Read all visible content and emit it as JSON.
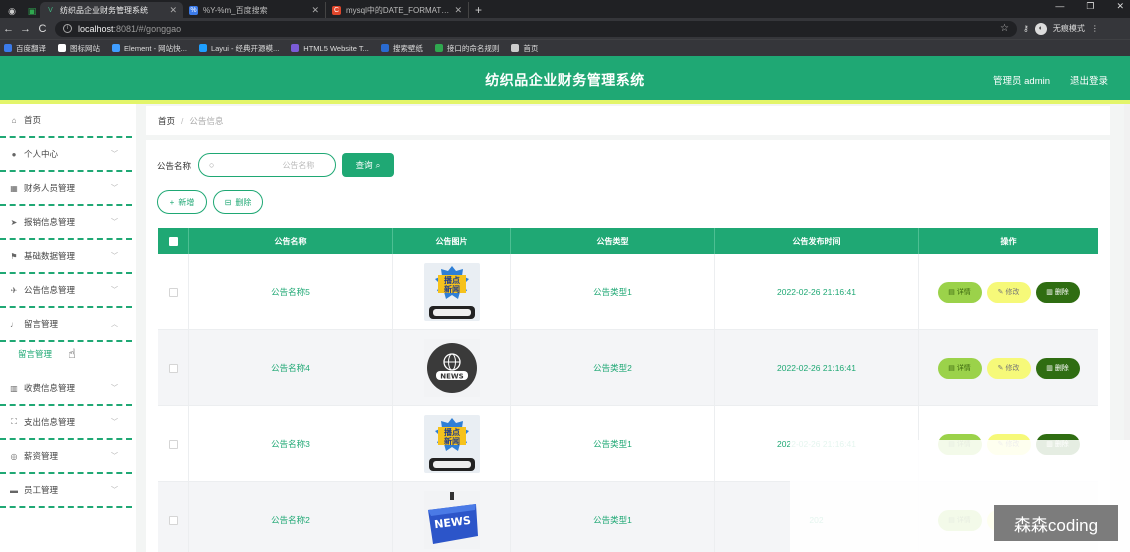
{
  "browser": {
    "tabs": [
      {
        "title": "纺织品企业财务管理系统",
        "active": true
      },
      {
        "title": "%Y-%m_百度搜索",
        "active": false
      },
      {
        "title": "mysql中的DATE_FORMAT(NO...",
        "active": false
      }
    ],
    "new_tab": "+",
    "url_host": "localhost",
    "url_path": ":8081/#/gonggao",
    "incognito_label": "无痕模式",
    "bookmarks": [
      {
        "label": "百度翻译",
        "color": "#3b7bea"
      },
      {
        "label": "图标网站",
        "color": "#ffffff"
      },
      {
        "label": "Element - 网站快...",
        "color": "#409eff"
      },
      {
        "label": "Layui - 经典开源模...",
        "color": "#1e9fff"
      },
      {
        "label": "HTML5 Website T...",
        "color": "#7b5cd6"
      },
      {
        "label": "搜索壁纸",
        "color": "#2a6bd1"
      },
      {
        "label": "接口的命名规则",
        "color": "#2fa84f"
      },
      {
        "label": "首页",
        "color": "#cccccc"
      }
    ]
  },
  "header": {
    "title": "纺织品企业财务管理系统",
    "user": "管理员 admin",
    "logout": "退出登录",
    "accent_color": "#1fa874",
    "stripe_color": "#e3f56a"
  },
  "sidebar": {
    "items": [
      {
        "label": "首页",
        "icon": "home-icon",
        "glyph": "⌂",
        "expandable": false
      },
      {
        "label": "个人中心",
        "icon": "user-icon",
        "glyph": "●",
        "expandable": true
      },
      {
        "label": "财务人员管理",
        "icon": "grid-icon",
        "glyph": "▦",
        "expandable": true
      },
      {
        "label": "报销信息管理",
        "icon": "send-icon",
        "glyph": "➤",
        "expandable": true
      },
      {
        "label": "基础数据管理",
        "icon": "flag-icon",
        "glyph": "⚑",
        "expandable": true
      },
      {
        "label": "公告信息管理",
        "icon": "plane-icon",
        "glyph": "✈",
        "expandable": true
      },
      {
        "label": "留言管理",
        "icon": "microphone-icon",
        "glyph": "♩",
        "expandable": true,
        "expanded": true
      },
      {
        "label": "收费信息管理",
        "icon": "chart-icon",
        "glyph": "▥",
        "expandable": true
      },
      {
        "label": "支出信息管理",
        "icon": "crop-icon",
        "glyph": "⛶",
        "expandable": true
      },
      {
        "label": "薪资管理",
        "icon": "globe-icon",
        "glyph": "◎",
        "expandable": true
      },
      {
        "label": "员工管理",
        "icon": "monitor-icon",
        "glyph": "▬",
        "expandable": true
      }
    ],
    "subitem": "留言管理"
  },
  "breadcrumb": {
    "home": "首页",
    "separator": "/",
    "current": "公告信息"
  },
  "search": {
    "label": "公告名称",
    "placeholder": "公告名称",
    "query_button": "查询"
  },
  "actions": {
    "add": "新增",
    "delete": "删除"
  },
  "table": {
    "columns": [
      "公告名称",
      "公告图片",
      "公告类型",
      "公告发布时间",
      "操作"
    ],
    "rows": [
      {
        "name": "公告名称5",
        "image": "breaking-news",
        "type": "公告类型1",
        "time": "2022-02-26 21:16:41"
      },
      {
        "name": "公告名称4",
        "image": "news-globe",
        "type": "公告类型2",
        "time": "2022-02-26 21:16:41"
      },
      {
        "name": "公告名称3",
        "image": "breaking-news",
        "type": "公告类型1",
        "time": "2022-02-26 21:16:41"
      },
      {
        "name": "公告名称2",
        "image": "news-key",
        "type": "公告类型1",
        "time": "202"
      }
    ],
    "row_actions": {
      "detail": "详情",
      "edit": "修改",
      "delete": "删除"
    }
  },
  "watermark": "森森coding"
}
